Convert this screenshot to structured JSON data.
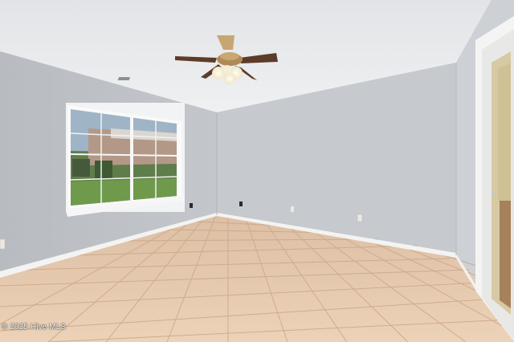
{
  "photo": {
    "subject": "empty-room-with-ceiling-fan-and-tile-floor",
    "watermark": "© 2025 Hive MLS"
  },
  "colors": {
    "ceiling": "#e9ebee",
    "wall_left": "#bfc3c8",
    "wall_back": "#c6c9cd",
    "wall_right": "#cfd2d6",
    "floor_tile": "#e7c9ad",
    "grout": "#cda98b",
    "baseboard": "#f4f4f4",
    "fan_blade": "#5a3a28",
    "fan_brass": "#b08a55"
  }
}
